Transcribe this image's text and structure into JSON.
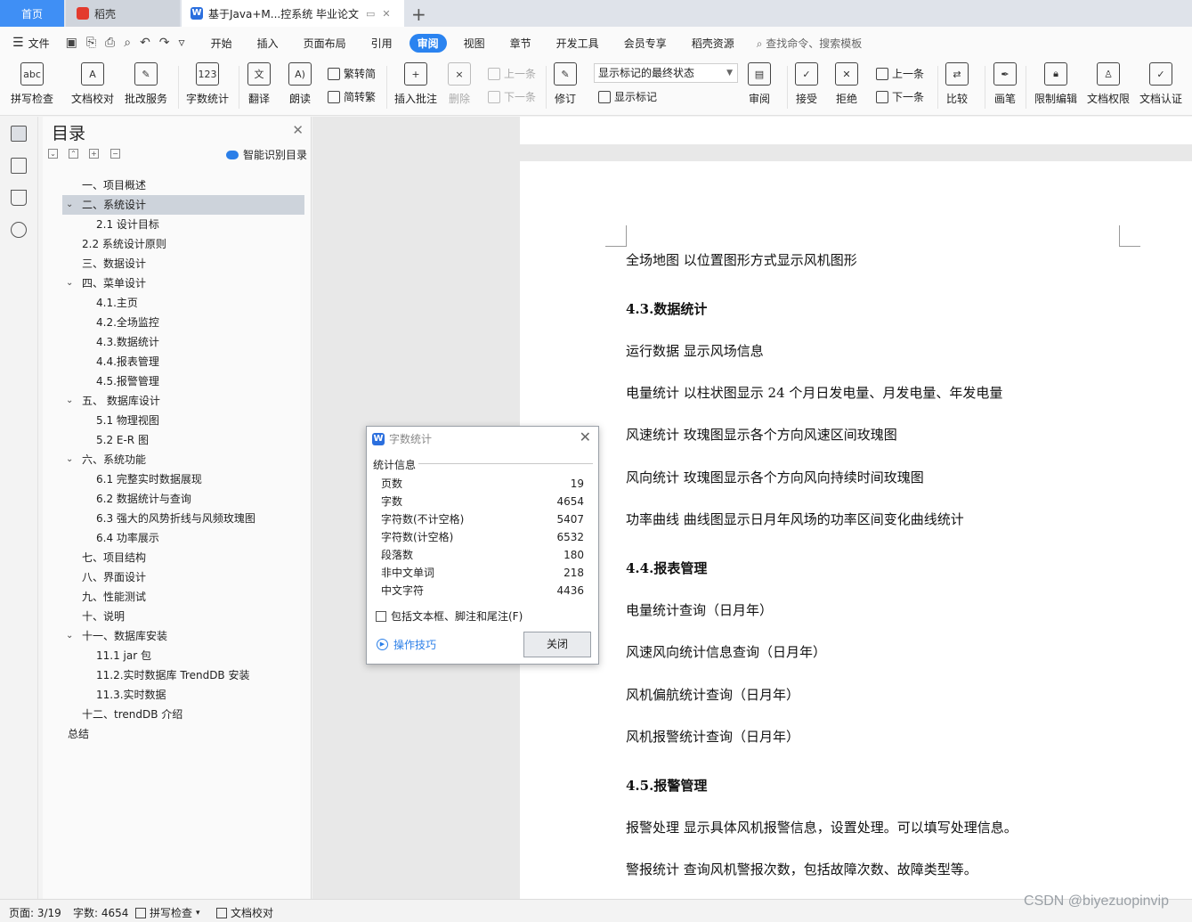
{
  "tabs": {
    "home": "首页",
    "daoke": "稻壳",
    "doc": "基于Java+M...控系统 毕业论文",
    "add": "+"
  },
  "menubar": {
    "file": "文件",
    "items": [
      "开始",
      "插入",
      "页面布局",
      "引用",
      "审阅",
      "视图",
      "章节",
      "开发工具",
      "会员专享",
      "稻壳资源"
    ],
    "active": "审阅",
    "search": "查找命令、搜索模板"
  },
  "ribbon": {
    "spell": "拼写检查",
    "proof": "文档校对",
    "revise_service": "批改服务",
    "word_count": "字数统计",
    "translate": "翻译",
    "read_aloud": "朗读",
    "to_traditional": "繁转简",
    "to_simplified": "简转繁",
    "insert_comment": "插入批注",
    "delete": "删除",
    "prev_comment": "上一条",
    "next_comment": "下一条",
    "track": "修订",
    "markup_state": "显示标记的最终状态",
    "show_markup": "显示标记",
    "review": "审阅",
    "accept": "接受",
    "reject": "拒绝",
    "prev_change": "上一条",
    "next_change": "下一条",
    "compare": "比较",
    "pen": "画笔",
    "restrict_edit": "限制编辑",
    "doc_permission": "文档权限",
    "doc_cert": "文档认证"
  },
  "nav": {
    "title": "目录",
    "smart": "智能识别目录",
    "items": [
      {
        "label": "一、项目概述",
        "level": 1,
        "caret": ""
      },
      {
        "label": "二、系统设计",
        "level": 1,
        "caret": "open",
        "selected": true
      },
      {
        "label": "2.1  设计目标",
        "level": 2,
        "caret": ""
      },
      {
        "label": "2.2  系统设计原则",
        "level": 1,
        "caret": ""
      },
      {
        "label": "三、数据设计",
        "level": 1,
        "caret": ""
      },
      {
        "label": "四、菜单设计",
        "level": 1,
        "caret": "open"
      },
      {
        "label": "4.1.主页",
        "level": 2,
        "caret": ""
      },
      {
        "label": "4.2.全场监控",
        "level": 2,
        "caret": ""
      },
      {
        "label": "4.3.数据统计",
        "level": 2,
        "caret": ""
      },
      {
        "label": "4.4.报表管理",
        "level": 2,
        "caret": ""
      },
      {
        "label": "4.5.报警管理",
        "level": 2,
        "caret": ""
      },
      {
        "label": "五、    数据库设计",
        "level": 1,
        "caret": "open"
      },
      {
        "label": "5.1  物理视图",
        "level": 2,
        "caret": ""
      },
      {
        "label": "5.2 E-R 图",
        "level": 2,
        "caret": ""
      },
      {
        "label": "六、系统功能",
        "level": 1,
        "caret": "open"
      },
      {
        "label": "6.1  完整实时数据展现",
        "level": 2,
        "caret": ""
      },
      {
        "label": "6.2  数据统计与查询",
        "level": 2,
        "caret": ""
      },
      {
        "label": "6.3  强大的风势折线与风频玫瑰图",
        "level": 2,
        "caret": ""
      },
      {
        "label": "6.4  功率展示",
        "level": 2,
        "caret": ""
      },
      {
        "label": "七、项目结构",
        "level": 1,
        "caret": ""
      },
      {
        "label": "八、界面设计",
        "level": 1,
        "caret": ""
      },
      {
        "label": "九、性能测试",
        "level": 1,
        "caret": ""
      },
      {
        "label": "十、说明",
        "level": 1,
        "caret": ""
      },
      {
        "label": "十一、数据库安装",
        "level": 1,
        "caret": "open"
      },
      {
        "label": "11.1 jar 包",
        "level": 2,
        "caret": ""
      },
      {
        "label": "11.2.实时数据库 TrendDB 安装",
        "level": 2,
        "caret": ""
      },
      {
        "label": "11.3.实时数据",
        "level": 2,
        "caret": ""
      },
      {
        "label": "十二、trendDB 介绍",
        "level": 1,
        "caret": ""
      },
      {
        "label": "总结",
        "level": 0,
        "caret": ""
      }
    ]
  },
  "document": {
    "paragraphs": [
      {
        "text": "全场地图  以位置图形方式显示风机图形",
        "heading": false
      },
      {
        "text": "4.3.数据统计",
        "heading": true
      },
      {
        "text": "运行数据  显示风场信息",
        "heading": false
      },
      {
        "text": "电量统计  以柱状图显示  24  个月日发电量、月发电量、年发电量",
        "heading": false
      },
      {
        "text": "风速统计  玫瑰图显示各个方向风速区间玫瑰图",
        "heading": false
      },
      {
        "text": "风向统计  玫瑰图显示各个方向风向持续时间玫瑰图",
        "heading": false
      },
      {
        "text": "功率曲线  曲线图显示日月年风场的功率区间变化曲线统计",
        "heading": false
      },
      {
        "text": "4.4.报表管理",
        "heading": true
      },
      {
        "text": "电量统计查询（日月年）",
        "heading": false
      },
      {
        "text": "风速风向统计信息查询（日月年）",
        "heading": false
      },
      {
        "text": "风机偏航统计查询（日月年）",
        "heading": false
      },
      {
        "text": "风机报警统计查询（日月年）",
        "heading": false
      },
      {
        "text": "4.5.报警管理",
        "heading": true
      },
      {
        "text": "报警处理  显示具体风机报警信息，设置处理。可以填写处理信息。",
        "heading": false
      },
      {
        "text": "警报统计  查询风机警报次数，包括故障次数、故障类型等。",
        "heading": false
      }
    ]
  },
  "dialog": {
    "title": "字数统计",
    "section": "统计信息",
    "stats": [
      {
        "label": "页数",
        "value": "19"
      },
      {
        "label": "字数",
        "value": "4654"
      },
      {
        "label": "字符数(不计空格)",
        "value": "5407"
      },
      {
        "label": "字符数(计空格)",
        "value": "6532"
      },
      {
        "label": "段落数",
        "value": "180"
      },
      {
        "label": "非中文单词",
        "value": "218"
      },
      {
        "label": "中文字符",
        "value": "4436"
      }
    ],
    "include_label": "包括文本框、脚注和尾注(F)",
    "tips": "操作技巧",
    "close": "关闭"
  },
  "status": {
    "page": "页面: 3/19",
    "words": "字数: 4654",
    "spell": "拼写检查",
    "proof": "文档校对"
  },
  "watermark": "CSDN @biyezuopinvip",
  "colors": {
    "accent": "#2a83f0",
    "home_tab": "#3f8ff5"
  }
}
